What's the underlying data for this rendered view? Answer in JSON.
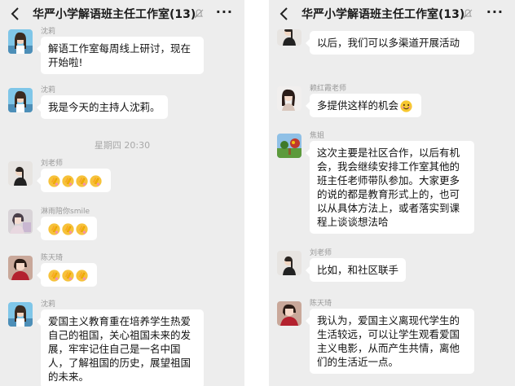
{
  "chat": {
    "title": "华严小学解语班主任工作室(13)",
    "more_label": "···"
  },
  "left": {
    "messages": [
      {
        "sender": "沈莉",
        "text": "解语工作室每周线上研讨，现在开始啦!"
      },
      {
        "sender": "沈莉",
        "text": "我是今天的主持人沈莉。"
      },
      {
        "sender": "刘老师",
        "emoji": "clap-hands x4"
      },
      {
        "sender": "淋雨陪你smile",
        "emoji": "clap-hands x3"
      },
      {
        "sender": "陈天琦",
        "emoji": "clap-hands x3"
      },
      {
        "sender": "沈莉",
        "text": "爱国主义教育重在培养学生热爱自己的祖国，关心祖国未来的发展，牢牢记住自己是一名中国人，了解祖国的历史，展望祖国的未来。"
      }
    ],
    "timestamp": "星期四 20:30"
  },
  "right": {
    "messages": [
      {
        "sender": "",
        "text": "以后，我们可以多渠道开展活动"
      },
      {
        "sender": "赖红霞老师",
        "text": "多提供这样的机会",
        "emoji": "smile"
      },
      {
        "sender": "焦姐",
        "text": "这次主要是社区合作，以后有机会，我会继续安排工作室其他的班主任老师带队参加。大家更多的说的都是教育形式上的，也可以从具体方法上，或者落实到课程上谈谈想法哈"
      },
      {
        "sender": "刘老师",
        "text": "比如，和社区联手"
      },
      {
        "sender": "陈天琦",
        "text": "我认为，爱国主义离现代学生的生活较远，可以让学生观看爱国主义电影，从而产生共情，离他们的生活近一点。"
      }
    ]
  },
  "colors": {
    "background": "#ededed",
    "bubble": "#ffffff",
    "sender": "#999999",
    "text": "#111111"
  },
  "icons": [
    "back-arrow-icon",
    "mute-bell-icon",
    "more-dots-icon",
    "clap-emoji-icon",
    "smile-emoji-icon"
  ]
}
